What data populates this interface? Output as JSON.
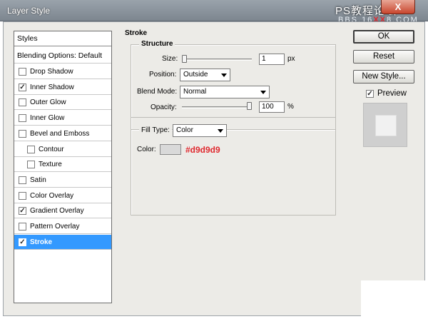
{
  "window": {
    "title": "Layer Style",
    "close_glyph": "X"
  },
  "watermark": {
    "line1": "PS教程论坛",
    "line2_a": "BBS.16",
    "line2_b": "XX",
    "line2_c": "8.COM"
  },
  "styles_panel": {
    "header": "Styles",
    "blending": "Blending Options: Default",
    "items": [
      {
        "label": "Drop Shadow",
        "checked": false,
        "sub": false
      },
      {
        "label": "Inner Shadow",
        "checked": true,
        "sub": false
      },
      {
        "label": "Outer Glow",
        "checked": false,
        "sub": false
      },
      {
        "label": "Inner Glow",
        "checked": false,
        "sub": false
      },
      {
        "label": "Bevel and Emboss",
        "checked": false,
        "sub": false
      },
      {
        "label": "Contour",
        "checked": false,
        "sub": true
      },
      {
        "label": "Texture",
        "checked": false,
        "sub": true
      },
      {
        "label": "Satin",
        "checked": false,
        "sub": false
      },
      {
        "label": "Color Overlay",
        "checked": false,
        "sub": false
      },
      {
        "label": "Gradient Overlay",
        "checked": true,
        "sub": false
      },
      {
        "label": "Pattern Overlay",
        "checked": false,
        "sub": false
      },
      {
        "label": "Stroke",
        "checked": true,
        "sub": false,
        "selected": true
      }
    ]
  },
  "stroke": {
    "title": "Stroke",
    "structure_title": "Structure",
    "size_label": "Size:",
    "size_value": "1",
    "size_unit": "px",
    "size_slider_fraction": 0.0,
    "position_label": "Position:",
    "position_value": "Outside",
    "blend_mode_label": "Blend Mode:",
    "blend_mode_value": "Normal",
    "opacity_label": "Opacity:",
    "opacity_value": "100",
    "opacity_unit": "%",
    "opacity_slider_fraction": 1.0,
    "fill_type_label": "Fill Type:",
    "fill_type_value": "Color",
    "color_label": "Color:",
    "color_hex": "#d9d9d9",
    "swatch_color": "#d9d9d9"
  },
  "buttons": {
    "ok": "OK",
    "reset": "Reset",
    "new_style": "New Style...",
    "preview_label": "Preview",
    "preview_checked": true
  },
  "colors": {
    "selection": "#3399ff",
    "accent_red": "#e0282e",
    "dialog_bg": "#ecebe7"
  },
  "icons": {
    "check": "✓",
    "dropdown": "chevron-down-icon",
    "close": "close-icon"
  }
}
